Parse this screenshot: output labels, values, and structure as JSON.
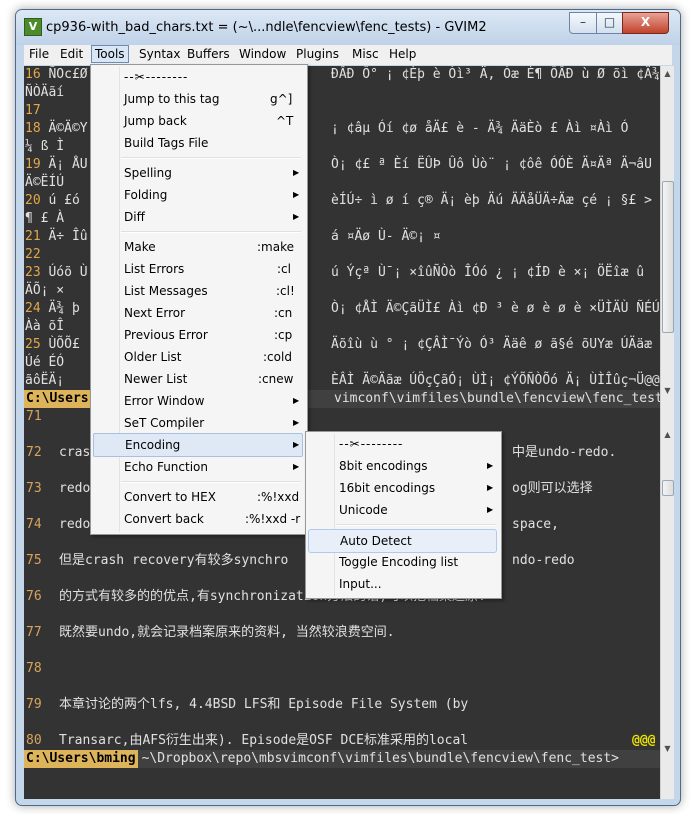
{
  "window": {
    "title": "cp936-with_bad_chars.txt = (~\\...ndle\\fencview\\fenc_tests) - GVIM2",
    "icon": "vim-icon",
    "controls": {
      "minimize": "–",
      "maximize": "□",
      "close": "X"
    }
  },
  "menubar": [
    "File",
    "Edit",
    "Tools",
    "Syntax",
    "Buffers",
    "Window",
    "Plugins",
    "Misc",
    "Help"
  ],
  "editor_top": {
    "lines": [
      {
        "n": "16",
        "t": "ÑOc£Ø",
        "tail": "ÐÂÐ Ô° ¡ ¢Èþ è Òì³ Ä, Òæ È¶ ÔÂÐ ù Ø õì ¢Ä¾"
      },
      {
        "n": "",
        "t": "ÑÒÄãí",
        "tail": ""
      },
      {
        "n": "17",
        "t": "",
        "tail": ""
      },
      {
        "n": "18",
        "t": "Ä©Ä©Y",
        "tail": "¡ ¢âµ Óí ¢ø åÄ£ è - Ä¾ ÄäÈò £ Àì ¤Àì Ó"
      },
      {
        "n": "",
        "t": "¼ ß Ì",
        "tail": ""
      },
      {
        "n": "19",
        "t": "Ä¡ ÅU",
        "tail": "Ò¡ ¢£ ª Èí ËÛÞ Ûô Ùò¨ ¡ ¢ôê ÓÓÈ Ä¤Äª Ä¬âU"
      },
      {
        "n": "",
        "t": "Ä©ËÍÚ",
        "tail": ""
      },
      {
        "n": "20",
        "t": "ú £ó",
        "tail": "èÍÚ÷ ì ø í ç® Ä¡ èþ Äú ÄÄåÜÄ÷Äæ çé ¡ §£ >"
      },
      {
        "n": "",
        "t": "¶ £ À",
        "tail": ""
      },
      {
        "n": "21",
        "t": "Ä÷ Îû",
        "tail": "á ¤Äø Ù- Ä©¡ ¤"
      },
      {
        "n": "22",
        "t": "",
        "tail": ""
      },
      {
        "n": "23",
        "t": "Úóõ Ù",
        "tail": "ú Ýçª Ù¯¡ ×îûÑÒò ÎÓó ¿ ¡ ¢ÍÐ è ×¡ ÖËîæ û"
      },
      {
        "n": "",
        "t": "ÄÕ¡ ×",
        "tail": ""
      },
      {
        "n": "24",
        "t": "Ä¾ þ",
        "tail": "Ò¡ ¢ÅÌ Ä©ÇãÜÌ£ Àì ¢Ð ³ è ø è ø è ×ÜÌÄÙ ÑÉÚ"
      },
      {
        "n": "",
        "t": "Àà õÎ",
        "tail": ""
      },
      {
        "n": "25",
        "t": "ÙÕÕ£",
        "tail": "Äõîù ù ° ¡ ¢ÇÂÌ¯Ýò Ó³ Ääê ø ã§é õUYæ ÚÄäæ"
      },
      {
        "n": "",
        "t": "Úé ÉÓ",
        "tail": ""
      },
      {
        "n": "",
        "t": "ãôËÄ¡",
        "tail": "ÈÂÌ Ä©Äãæ ÚÖçÇãÓ¡ ÙÌ¡ ¢ÝÕÑÒÕó Ä¡ ÙÌÎûç¬Ü@@@"
      }
    ],
    "status": {
      "user": "C:\\Users",
      "path": "vimconf\\vimfiles\\bundle\\fencview\\fenc_test>"
    }
  },
  "editor_bottom": {
    "lines": [
      {
        "n": "71",
        "t": ""
      },
      {
        "n": "72",
        "t": "cras",
        "tail": "中是undo-redo."
      },
      {
        "n": "73",
        "t": "redo",
        "tail": "og则可以选择"
      },
      {
        "n": "74",
        "t": "redo",
        "tail": "space,"
      },
      {
        "n": "75",
        "t": "但是crash recovery有较多synchro",
        "tail": "ndo-redo"
      },
      {
        "n": "76",
        "t": "的方式有较多的的优点,有synchronization方法的话,可以把档案还原."
      },
      {
        "n": "77",
        "t": "既然要undo,就会记录档案原来的资料, 当然较浪费空间."
      },
      {
        "n": "78",
        "t": ""
      },
      {
        "n": "79",
        "t": "本章讨论的两个lfs, 4.4BSD LFS和 Episode File System (by"
      },
      {
        "n": "80",
        "t": "Transarc,由AFS衍生出来). Episode是OSF DCE标准采用的local",
        "marks": "@@@"
      }
    ],
    "status": {
      "user": "C:\\Users\\bming",
      "path": "~\\Dropbox\\repo\\mbsvimconf\\vimfiles\\bundle\\fencview\\fenc_test>"
    }
  },
  "tools_menu": {
    "tearoff": "--✂--------",
    "items": [
      {
        "label": "Jump to this tag",
        "acc": "g^]"
      },
      {
        "label": "Jump back",
        "acc": "^T"
      },
      {
        "label": "Build Tags File",
        "acc": ""
      },
      {
        "label": "Spelling",
        "acc": "",
        "sub": true
      },
      {
        "label": "Folding",
        "acc": "",
        "sub": true
      },
      {
        "label": "Diff",
        "acc": "",
        "sub": true
      },
      {
        "label": "Make",
        "acc": ":make"
      },
      {
        "label": "List Errors",
        "acc": ":cl"
      },
      {
        "label": "List Messages",
        "acc": ":cl!"
      },
      {
        "label": "Next Error",
        "acc": ":cn"
      },
      {
        "label": "Previous Error",
        "acc": ":cp"
      },
      {
        "label": "Older List",
        "acc": ":cold"
      },
      {
        "label": "Newer List",
        "acc": ":cnew"
      },
      {
        "label": "Error Window",
        "acc": "",
        "sub": true
      },
      {
        "label": "SeT Compiler",
        "acc": "",
        "sub": true
      },
      {
        "label": "Encoding",
        "acc": "",
        "sub": true
      },
      {
        "label": "Echo Function",
        "acc": "",
        "sub": true
      },
      {
        "label": "Convert to HEX",
        "acc": ":%!xxd"
      },
      {
        "label": "Convert back",
        "acc": ":%!xxd -r"
      }
    ]
  },
  "encoding_menu": {
    "tearoff": "--✂--------",
    "items": [
      {
        "label": "8bit encodings",
        "sub": true
      },
      {
        "label": "16bit encodings",
        "sub": true
      },
      {
        "label": "Unicode",
        "sub": true
      },
      {
        "label": "Auto Detect",
        "sub": false
      },
      {
        "label": "Toggle Encoding list",
        "sub": false
      },
      {
        "label": "Input...",
        "sub": false
      }
    ]
  }
}
